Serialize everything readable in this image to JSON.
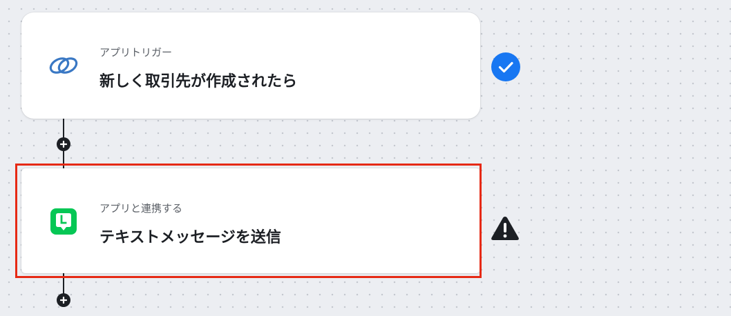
{
  "steps": [
    {
      "type_label": "アプリトリガー",
      "title": "新しく取引先が作成されたら",
      "app_icon": "link-rings-icon",
      "status": "complete",
      "status_icon": "check-icon",
      "status_color": "#1877f2"
    },
    {
      "type_label": "アプリと連携する",
      "title": "テキストメッセージを送信",
      "app_icon": "line-app-icon",
      "status": "warning",
      "status_icon": "warning-icon",
      "status_color": "#1c1f24",
      "highlighted": true
    }
  ],
  "colors": {
    "accent_blue": "#1877f2",
    "line_green": "#06c755",
    "highlight_red": "#e62914",
    "app_icon_blue": "#3a78c4",
    "connector": "#1c1f24"
  }
}
